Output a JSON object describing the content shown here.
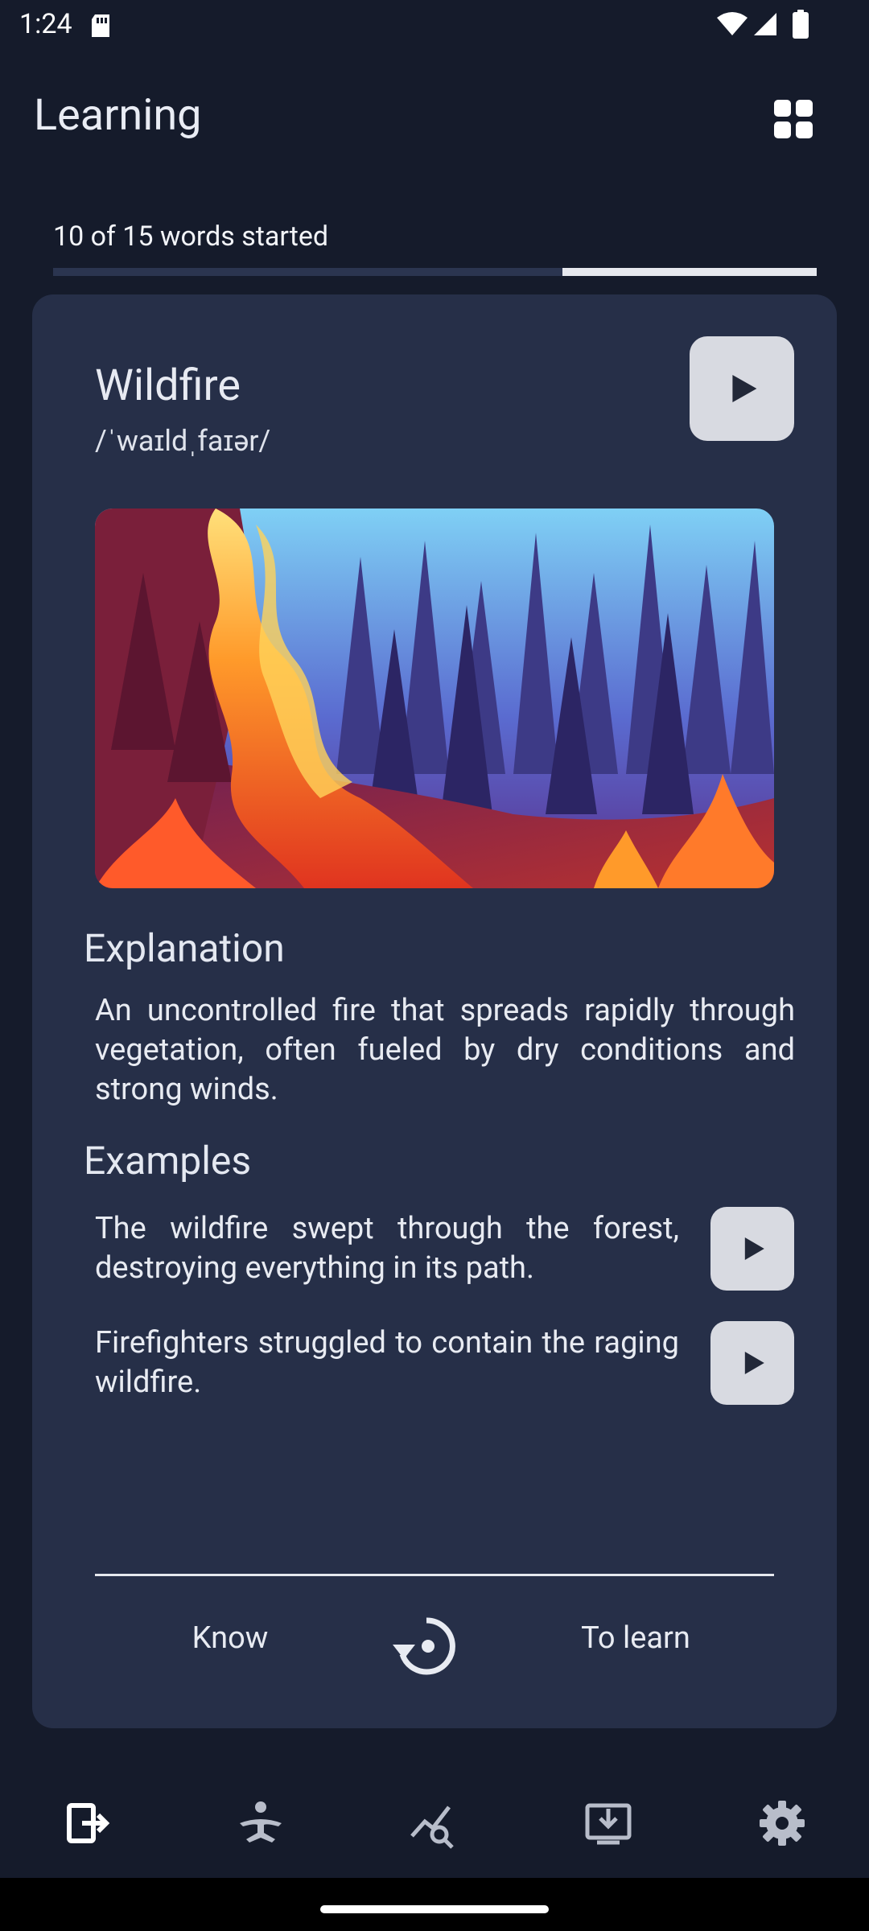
{
  "status_bar": {
    "time": "1:24"
  },
  "app_bar": {
    "title": "Learning"
  },
  "progress": {
    "text": "10 of 15 words started",
    "started": 10,
    "total": 15,
    "fraction_started": 0.6667
  },
  "word": {
    "title": "Wildfire",
    "phonetic": "/ˈwaɪldˌfaɪər/"
  },
  "explanation": {
    "heading": "Explanation",
    "text": "An uncontrolled fire that spreads rapidly through vegetation, often fueled by dry conditions and strong winds."
  },
  "examples": {
    "heading": "Examples",
    "items": [
      {
        "text": "The wildfire swept through the forest, destroying everything in its path."
      },
      {
        "text": "Firefighters struggled to contain the raging wildfire."
      }
    ]
  },
  "actions": {
    "know": "Know",
    "to_learn": "To learn"
  },
  "colors": {
    "background": "#151b2b",
    "card": "#262f48",
    "button_light": "#d8dae1",
    "progress_track": "#2b3550",
    "progress_fill": "#e6e8ee"
  },
  "icons": {
    "grid": "grid-icon",
    "play": "play-icon",
    "reset": "history-icon",
    "nav": [
      "learning-icon",
      "exercise-icon",
      "review-icon",
      "download-icon",
      "settings-icon"
    ]
  }
}
